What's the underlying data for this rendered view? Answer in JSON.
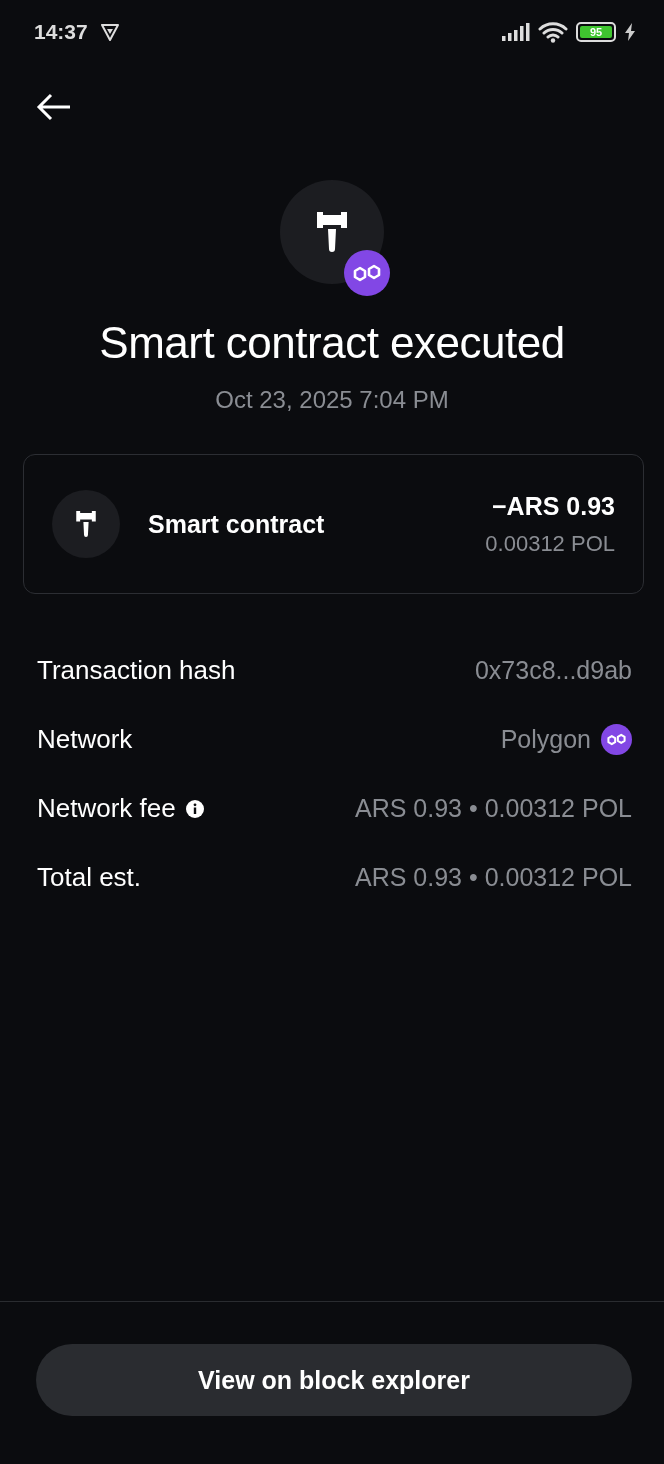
{
  "status_bar": {
    "time": "14:37",
    "battery": "95"
  },
  "header": {
    "title": "Smart contract executed",
    "date": "Oct 23, 2025 7:04 PM"
  },
  "summary": {
    "label": "Smart contract",
    "amount": "−ARS 0.93",
    "crypto_amount": "0.00312 POL"
  },
  "details": [
    {
      "kind": "plain",
      "label": "Transaction hash",
      "value": "0x73c8...d9ab"
    },
    {
      "kind": "network",
      "label": "Network",
      "value": "Polygon"
    },
    {
      "kind": "info",
      "label": "Network fee",
      "value": "ARS 0.93 • 0.00312 POL"
    },
    {
      "kind": "plain",
      "label": "Total est.",
      "value": "ARS 0.93 • 0.00312 POL"
    }
  ],
  "button": "View on block explorer"
}
